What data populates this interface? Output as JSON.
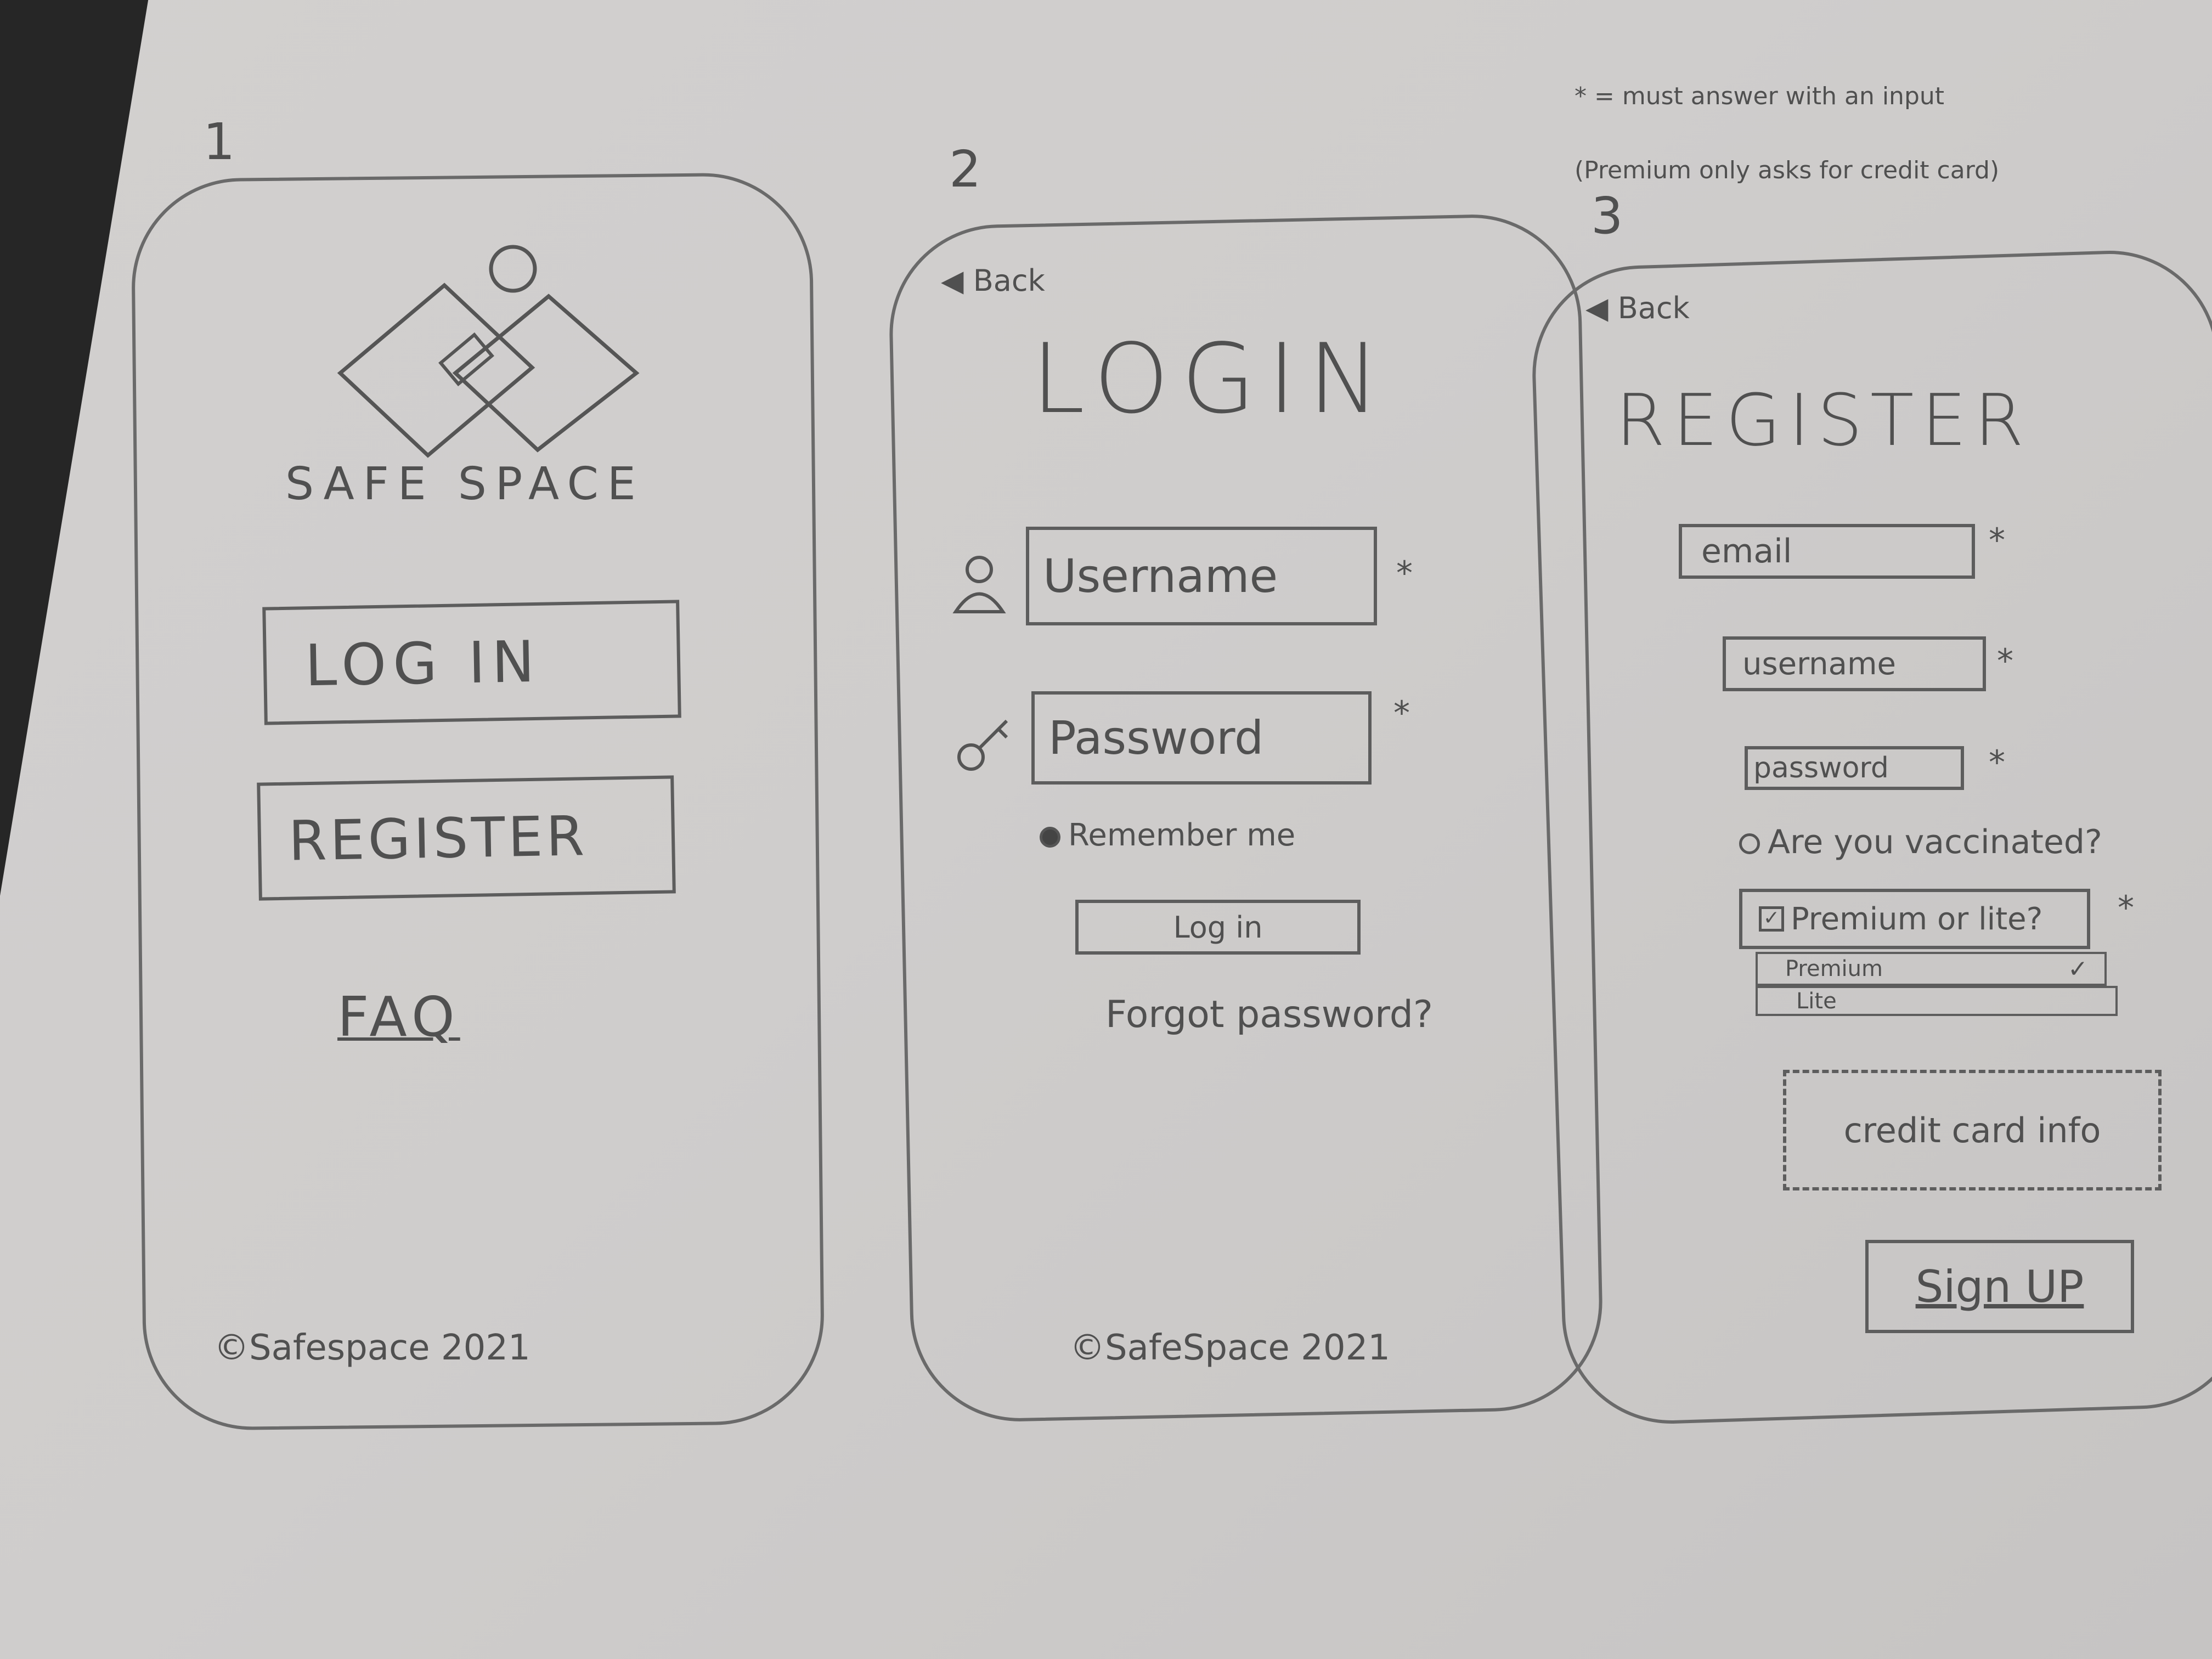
{
  "note": {
    "line1": "* = must answer with an input",
    "line2": "(Premium only asks for credit card)"
  },
  "screen1": {
    "number": "1",
    "brand_name": "SAFE SPACE",
    "login_button": "LOG IN",
    "register_button": "REGISTER",
    "faq_link": "FAQ",
    "footer": "©Safespace 2021"
  },
  "screen2": {
    "number": "2",
    "back_label": "Back",
    "title": "LOGIN",
    "username_placeholder": "Username",
    "password_placeholder": "Password",
    "required_mark": "*",
    "remember_me": "Remember me",
    "login_button": "Log in",
    "forgot_password": "Forgot password?",
    "footer": "©SafeSpace 2021"
  },
  "screen3": {
    "number": "3",
    "back_label": "Back",
    "title": "REGISTER",
    "email_placeholder": "email",
    "username_placeholder": "username",
    "password_placeholder": "password",
    "required_mark": "*",
    "vaccinated_question": "Are you vaccinated?",
    "plan_question": "Premium or lite?",
    "plan_options": [
      "Premium",
      "Lite"
    ],
    "checkmark": "✓",
    "credit_card": "credit card info",
    "signup_button": "Sign UP"
  }
}
